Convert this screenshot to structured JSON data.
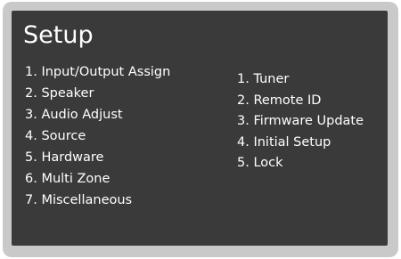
{
  "screen": {
    "title": "Setup"
  },
  "menu_left": {
    "items": [
      {
        "label": "1.  Input/Output Assign"
      },
      {
        "label": "2.  Speaker"
      },
      {
        "label": "3.  Audio Adjust"
      },
      {
        "label": "4.  Source"
      },
      {
        "label": "5.  Hardware"
      },
      {
        "label": "6.  Multi Zone"
      },
      {
        "label": "7.  Miscellaneous"
      }
    ]
  },
  "menu_right": {
    "items": [
      {
        "label": "1.  Tuner"
      },
      {
        "label": "2.  Remote ID"
      },
      {
        "label": "3.  Firmware Update"
      },
      {
        "label": "4.  Initial Setup"
      },
      {
        "label": "5. Lock"
      }
    ]
  },
  "colors": {
    "bezel": "#c9c9c9",
    "screen_bg": "#3a3a3a",
    "text": "#ffffff"
  }
}
